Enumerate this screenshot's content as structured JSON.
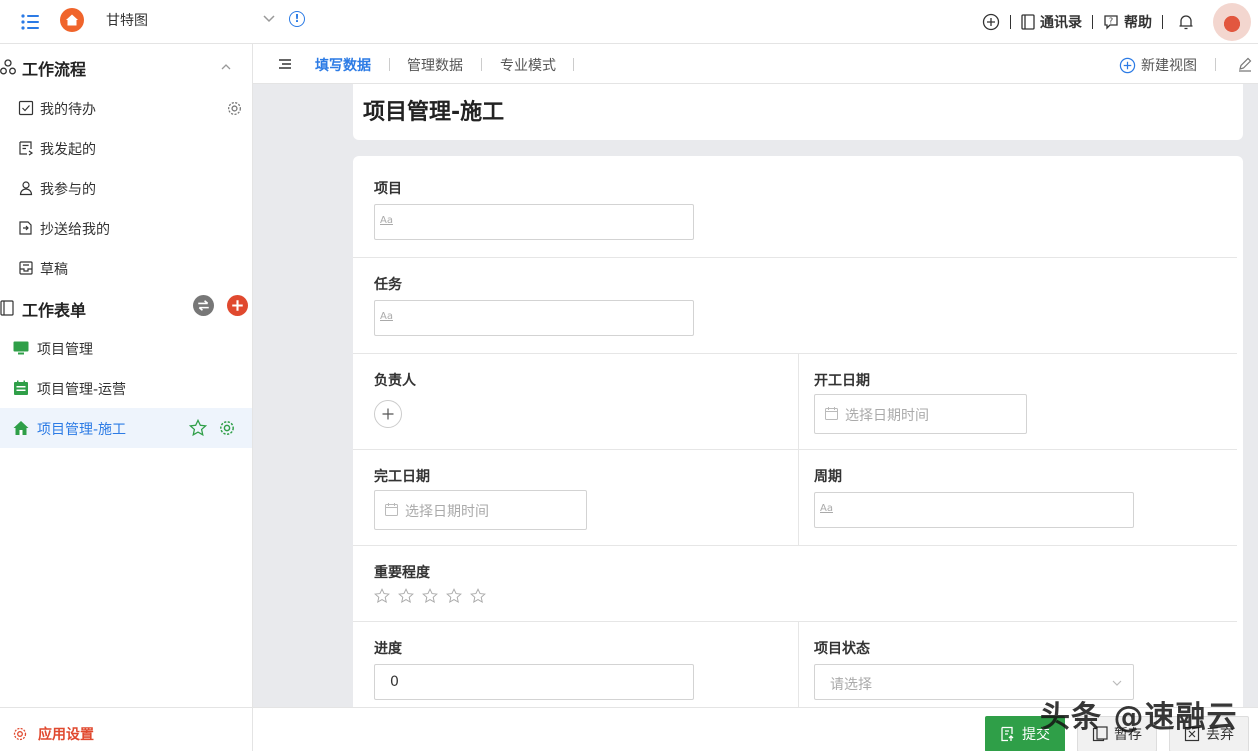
{
  "topbar": {
    "app_title": "甘特图",
    "contacts_label": "通讯录",
    "help_label": "帮助"
  },
  "sidebar": {
    "workflow_title": "工作流程",
    "workflow_items": [
      {
        "label": "我的待办"
      },
      {
        "label": "我发起的"
      },
      {
        "label": "我参与的"
      },
      {
        "label": "抄送给我的"
      },
      {
        "label": "草稿"
      }
    ],
    "forms_title": "工作表单",
    "form_items": [
      {
        "label": "项目管理"
      },
      {
        "label": "项目管理-运营"
      },
      {
        "label": "项目管理-施工"
      }
    ],
    "settings_label": "应用设置"
  },
  "tabs": {
    "items": [
      {
        "label": "填写数据"
      },
      {
        "label": "管理数据"
      },
      {
        "label": "专业模式"
      }
    ],
    "new_view_label": "新建视图"
  },
  "form": {
    "title": "项目管理-施工",
    "project_label": "项目",
    "project_placeholder": "Aa",
    "task_label": "任务",
    "task_placeholder": "Aa",
    "owner_label": "负责人",
    "start_date_label": "开工日期",
    "start_date_placeholder": "选择日期时间",
    "end_date_label": "完工日期",
    "end_date_placeholder": "选择日期时间",
    "period_label": "周期",
    "period_placeholder": "Aa",
    "importance_label": "重要程度",
    "importance_rating": 0,
    "importance_max": 5,
    "progress_label": "进度",
    "progress_value": "0",
    "status_label": "项目状态",
    "status_placeholder": "请选择"
  },
  "footer": {
    "submit_label": "提交",
    "save_label": "暂存",
    "discard_label": "丢弃"
  },
  "watermark": "头条 @速融云",
  "colors": {
    "accent": "#2c7be5",
    "home": "#f0642b",
    "submit": "#2f9f48",
    "danger": "#e0492f"
  }
}
